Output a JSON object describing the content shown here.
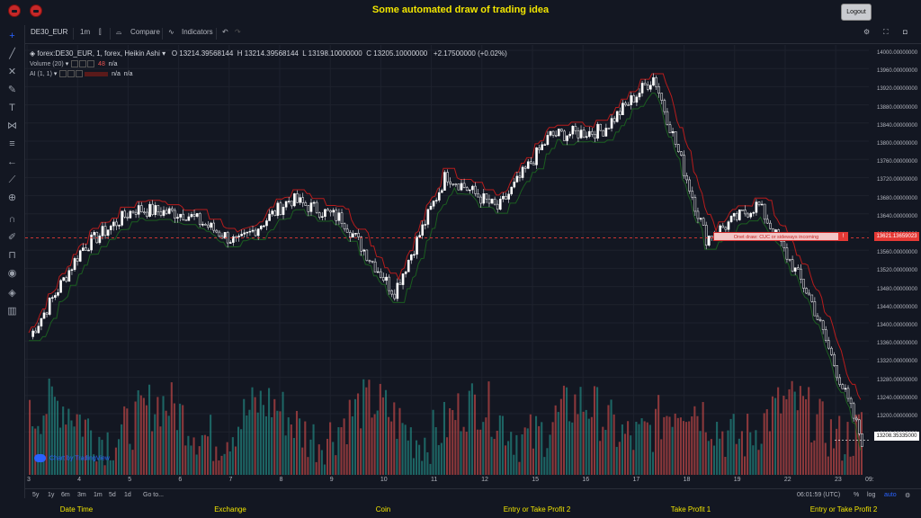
{
  "app": {
    "title": "Some automated draw of trading idea",
    "logout_label": "Logout"
  },
  "toolbar": {
    "symbol": "DE30_EUR",
    "interval": "1m",
    "compare_label": "Compare",
    "indicators_label": "Indicators"
  },
  "legend": {
    "series_title": "forex:DE30_EUR, 1, forex, Heikin Ashi",
    "open": "O 13214.39568144",
    "high": "H 13214.39568144",
    "low": "L 13198.10000000",
    "close": "C 13205.10000000",
    "change": "+2.17500000 (+0.02%)",
    "volume_label": "Volume (20)",
    "volume_value": "48",
    "volume_na": "n/a",
    "ai_label": "AI (1, 1)",
    "ai_na1": "n/a",
    "ai_na2": "n/a"
  },
  "price_axis": {
    "labels": [
      "14000.00000000",
      "13960.00000000",
      "13920.00000000",
      "13880.00000000",
      "13840.00000000",
      "13800.00000000",
      "13760.00000000",
      "13720.00000000",
      "13680.00000000",
      "13640.00000000",
      "13600.00000000",
      "13560.00000000",
      "13520.00000000",
      "13480.00000000",
      "13440.00000000",
      "13400.00000000",
      "13360.00000000",
      "13320.00000000",
      "13280.00000000",
      "13240.00000000",
      "13200.00000000",
      "13160.00000000"
    ],
    "last_price": "13208.35335000",
    "alert_price": "13621.13659023"
  },
  "annotation": {
    "text": "Onet draw: CUC or sideways incoming",
    "marker": "!"
  },
  "time_axis": {
    "labels": [
      "3",
      "4",
      "5",
      "6",
      "7",
      "8",
      "9",
      "10",
      "11",
      "12",
      "15",
      "16",
      "17",
      "18",
      "19",
      "22",
      "23"
    ],
    "end_label": "09:"
  },
  "bottom_toolbar": {
    "ranges": [
      "5y",
      "1y",
      "6m",
      "3m",
      "1m",
      "5d",
      "1d"
    ],
    "goto_label": "Go to...",
    "clock": "06:01:59 (UTC)",
    "percent_label": "%",
    "log_label": "log",
    "auto_label": "auto"
  },
  "watermark": "Chart by TradingView",
  "footer": {
    "columns": [
      "Date Time",
      "Exchange",
      "Coin",
      "Entry or Take Profit 2",
      "Take Profit 1",
      "Entry or Take Profit 2"
    ]
  },
  "colors": {
    "background": "#131722",
    "up_volume": "#26a69a",
    "down_volume": "#ef5350",
    "upper_band": "#b71c1c",
    "lower_band": "#1b5e20",
    "candles": "#ffffff",
    "title": "#f2e600"
  },
  "chart_data": {
    "type": "line",
    "title": "",
    "y_range": [
      13160,
      14000
    ],
    "x_ticks": [
      "3",
      "4",
      "5",
      "6",
      "7",
      "8",
      "9",
      "10",
      "11",
      "12",
      "15",
      "16",
      "17",
      "18",
      "19",
      "22",
      "23"
    ],
    "price_series": {
      "x": [
        "3",
        "4",
        "5",
        "6",
        "7",
        "8",
        "9",
        "10",
        "11",
        "12",
        "15",
        "16",
        "17",
        "18",
        "19",
        "22",
        "23"
      ],
      "y": [
        13420,
        13600,
        13680,
        13670,
        13610,
        13700,
        13660,
        13510,
        13750,
        13680,
        13830,
        13840,
        13950,
        13620,
        13690,
        13500,
        13208
      ]
    }
  }
}
